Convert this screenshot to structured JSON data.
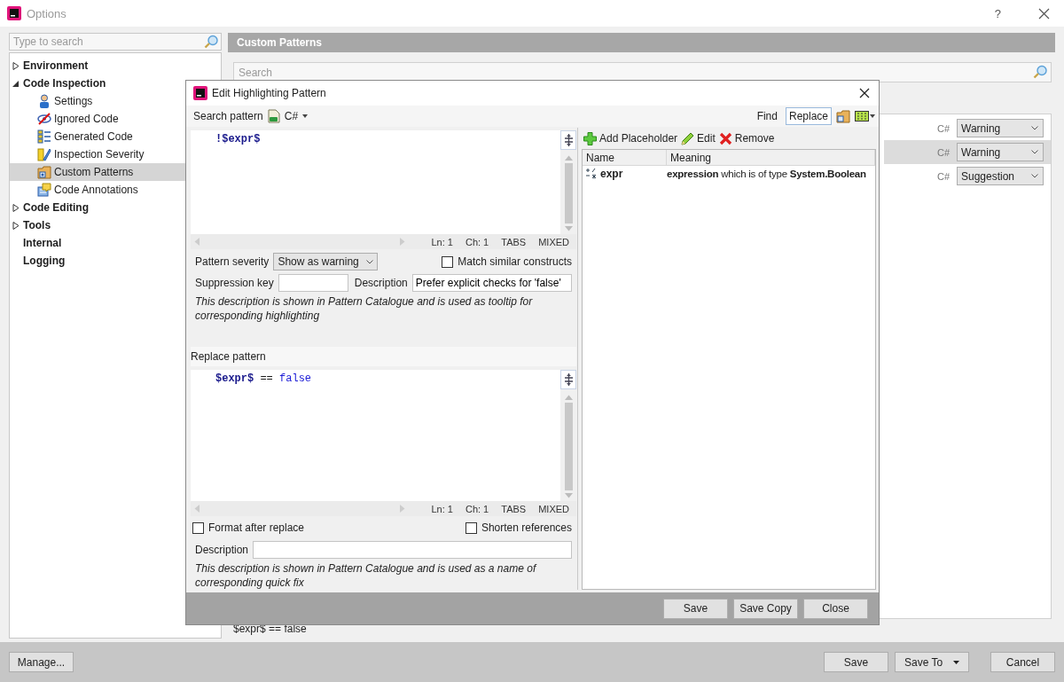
{
  "window": {
    "title": "Options",
    "help": "?"
  },
  "sidebar": {
    "search_placeholder": "Type to search",
    "items": [
      {
        "label": "Environment",
        "expanded": false,
        "selected": false
      },
      {
        "label": "Code Inspection",
        "expanded": true,
        "selected": false,
        "children": [
          {
            "label": "Settings",
            "kind": "person",
            "selected": false
          },
          {
            "label": "Ignored Code",
            "kind": "crossed-eye",
            "selected": false
          },
          {
            "label": "Generated Code",
            "kind": "list",
            "selected": false
          },
          {
            "label": "Inspection Severity",
            "kind": "brush",
            "selected": false
          },
          {
            "label": "Custom Patterns",
            "kind": "folder",
            "selected": true
          },
          {
            "label": "Code Annotations",
            "kind": "note",
            "selected": false
          }
        ]
      },
      {
        "label": "Code Editing",
        "expanded": false,
        "selected": false
      },
      {
        "label": "Tools",
        "expanded": false,
        "selected": false
      },
      {
        "label": "Internal",
        "selected": false
      },
      {
        "label": "Logging",
        "selected": false
      }
    ]
  },
  "panel": {
    "title": "Custom Patterns",
    "search_placeholder": "Search",
    "rows": [
      {
        "language": "C#",
        "severity": "Warning",
        "selected": false
      },
      {
        "language": "C#",
        "severity": "Warning",
        "selected": true
      },
      {
        "language": "C#",
        "severity": "Suggestion",
        "selected": false
      }
    ],
    "preview": "$expr$ == false"
  },
  "dialog": {
    "title": "Edit Highlighting Pattern",
    "search_label": "Search pattern",
    "language": "C#",
    "modes": [
      {
        "label": "Find",
        "selected": false
      },
      {
        "label": "Replace",
        "selected": true
      }
    ],
    "search_code": [
      {
        "kind": "operator",
        "text": "!"
      },
      {
        "kind": "placeholder",
        "text": "$expr$"
      }
    ],
    "search_status": [
      "Ln: 1",
      "Ch: 1",
      "TABS",
      "MIXED"
    ],
    "severity_label": "Pattern severity",
    "severity": "Show as warning",
    "match_similar": {
      "label": "Match similar constructs",
      "checked": false
    },
    "suppression_label": "Suppression key",
    "description_label": "Description",
    "description": "Prefer explicit checks for 'false'",
    "description_note": "This description is shown in Pattern Catalogue and is used as tooltip for corresponding highlighting",
    "replace_label": "Replace pattern",
    "replace_code": [
      {
        "kind": "placeholder",
        "text": "$expr$"
      },
      {
        "kind": "operator",
        "text": " == "
      },
      {
        "kind": "keyword",
        "text": "false"
      }
    ],
    "replace_status": [
      "Ln: 1",
      "Ch: 1",
      "TABS",
      "MIXED"
    ],
    "format_after_replace": {
      "label": "Format after replace",
      "checked": false
    },
    "shorten_references": {
      "label": "Shorten references",
      "checked": false
    },
    "replace_description_label": "Description",
    "replace_note": "This description is shown in Pattern Catalogue and is used as a name of corresponding quick fix",
    "placeholder_tools": [
      {
        "kind": "add",
        "label": "Add Placeholder"
      },
      {
        "kind": "edit",
        "label": "Edit"
      },
      {
        "kind": "remove",
        "label": "Remove"
      }
    ],
    "placeholder_columns": [
      "Name",
      "Meaning"
    ],
    "placeholders": [
      {
        "name": "expr",
        "meaning": "**expression** which is of type **System.Boolean**"
      }
    ],
    "buttons": [
      "Save",
      "Save Copy",
      "Close"
    ]
  },
  "footer": {
    "manage": "Manage...",
    "buttons": [
      {
        "kind": "plain",
        "label": "Save"
      },
      {
        "kind": "split",
        "label": "Save To"
      },
      {
        "kind": "plain",
        "label": "Cancel"
      }
    ]
  }
}
